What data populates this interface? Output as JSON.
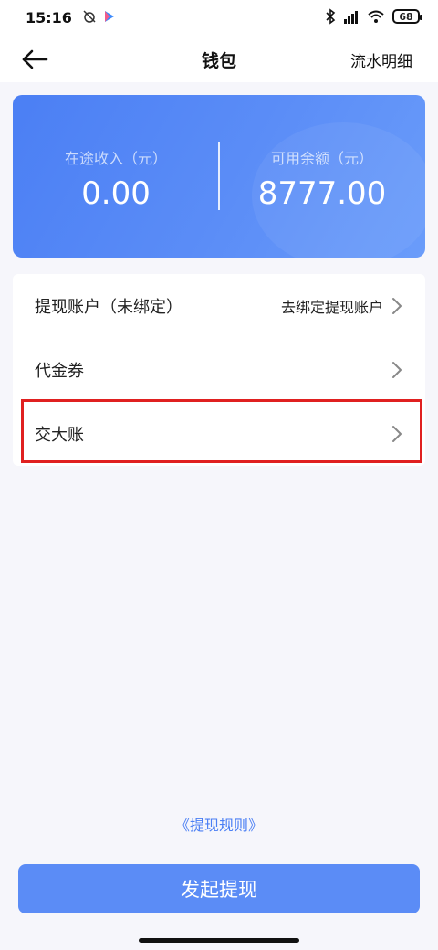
{
  "status_bar": {
    "time": "15:16",
    "battery": "68"
  },
  "header": {
    "title": "钱包",
    "detail_label": "流水明细"
  },
  "wallet_card": {
    "in_transit_label": "在途收入（元）",
    "in_transit_amount": "0.00",
    "available_label": "可用余额（元）",
    "available_amount": "8777.00"
  },
  "menu": {
    "items": [
      {
        "label": "提现账户（未绑定）",
        "value": "去绑定提现账户"
      },
      {
        "label": "代金券",
        "value": ""
      },
      {
        "label": "交大账",
        "value": ""
      }
    ]
  },
  "rules_link": "《提现规则》",
  "submit_label": "发起提现",
  "colors": {
    "accent": "#4b7ff4",
    "button": "#5b8cf6",
    "highlight": "#e02020"
  }
}
